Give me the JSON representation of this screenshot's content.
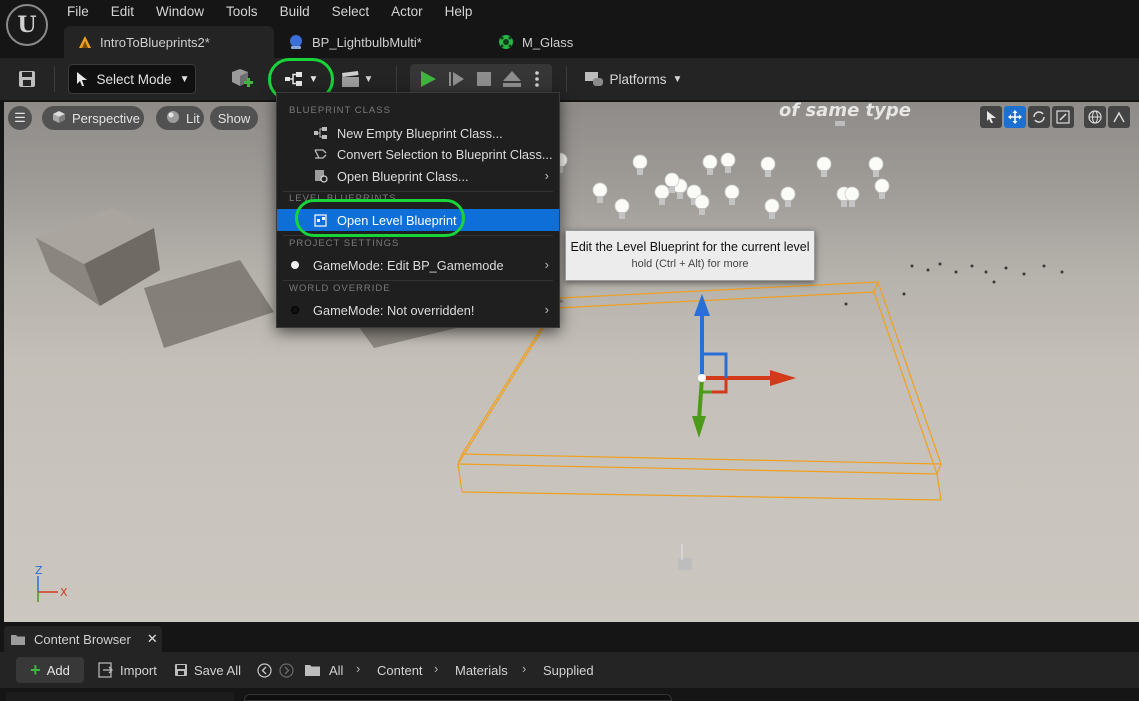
{
  "app": {
    "logo_letter": "U"
  },
  "menu": [
    "File",
    "Edit",
    "Window",
    "Tools",
    "Build",
    "Select",
    "Actor",
    "Help"
  ],
  "tabs": [
    {
      "label": "IntroToBlueprints2*",
      "icon": "level-icon",
      "color": "#f0a020"
    },
    {
      "label": "BP_LightbulbMulti*",
      "icon": "blueprint-icon",
      "color": "#3b6fd6"
    },
    {
      "label": "M_Glass",
      "icon": "material-icon",
      "color": "#28b446"
    }
  ],
  "toolbar": {
    "select_mode_label": "Select Mode",
    "platforms_label": "Platforms"
  },
  "viewport": {
    "perspective_label": "Perspective",
    "lit_label": "Lit",
    "show_label": "Show",
    "scene_note": "of same type"
  },
  "dropdown": {
    "sections": {
      "blueprint_class": "BLUEPRINT CLASS",
      "level_blueprints": "LEVEL BLUEPRINTS",
      "project_settings": "PROJECT SETTINGS",
      "world_override": "WORLD OVERRIDE"
    },
    "items": {
      "new_empty": "New Empty Blueprint Class...",
      "convert_selection": "Convert Selection to Blueprint Class...",
      "open_blueprint_class": "Open Blueprint Class...",
      "open_level_blueprint": "Open Level Blueprint",
      "gamemode_edit": "GameMode: Edit BP_Gamemode",
      "gamemode_not_overridden": "GameMode: Not overridden!"
    }
  },
  "tooltip": {
    "title": "Edit the Level Blueprint for the current level",
    "hint": "hold (Ctrl + Alt) for more"
  },
  "content_browser": {
    "tab_label": "Content Browser",
    "add_label": "Add",
    "import_label": "Import",
    "save_all_label": "Save All",
    "breadcrumbs": [
      "All",
      "Content",
      "Materials",
      "Supplied"
    ]
  },
  "colors": {
    "highlight": "#0e6fd8",
    "annotation_circle": "#19d33a",
    "play_green": "#3fb63f",
    "gizmo_x": "#d23a1a",
    "gizmo_y": "#4c9a1a",
    "gizmo_z": "#2a6fd6",
    "selection_box": "#f0a020"
  }
}
